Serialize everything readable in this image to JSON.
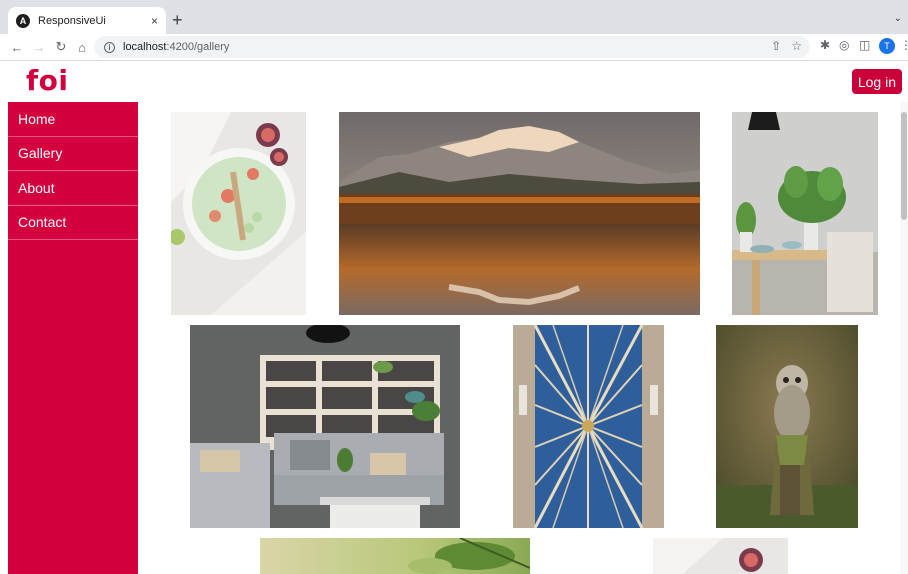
{
  "browser": {
    "tab_title": "ResponsiveUi",
    "tab_favicon_letter": "A",
    "tab_close": "×",
    "new_tab": "+",
    "url_host": "localhost",
    "url_path": ":4200/gallery",
    "profile_initial": "T"
  },
  "header": {
    "logo": "foi",
    "login_label": "Log in"
  },
  "sidebar": {
    "items": [
      {
        "label": "Home"
      },
      {
        "label": "Gallery"
      },
      {
        "label": "About"
      },
      {
        "label": "Contact"
      }
    ]
  },
  "colors": {
    "brand": "#d4003e",
    "button": "#cc0038"
  },
  "gallery": {
    "photos": [
      {
        "name": "smoothie-bowl-photo"
      },
      {
        "name": "mountain-lake-photo"
      },
      {
        "name": "dining-plant-photo"
      },
      {
        "name": "living-room-photo"
      },
      {
        "name": "vaulted-ceiling-photo"
      },
      {
        "name": "owl-photo"
      },
      {
        "name": "green-plant-photo"
      },
      {
        "name": "figs-photo"
      }
    ]
  }
}
